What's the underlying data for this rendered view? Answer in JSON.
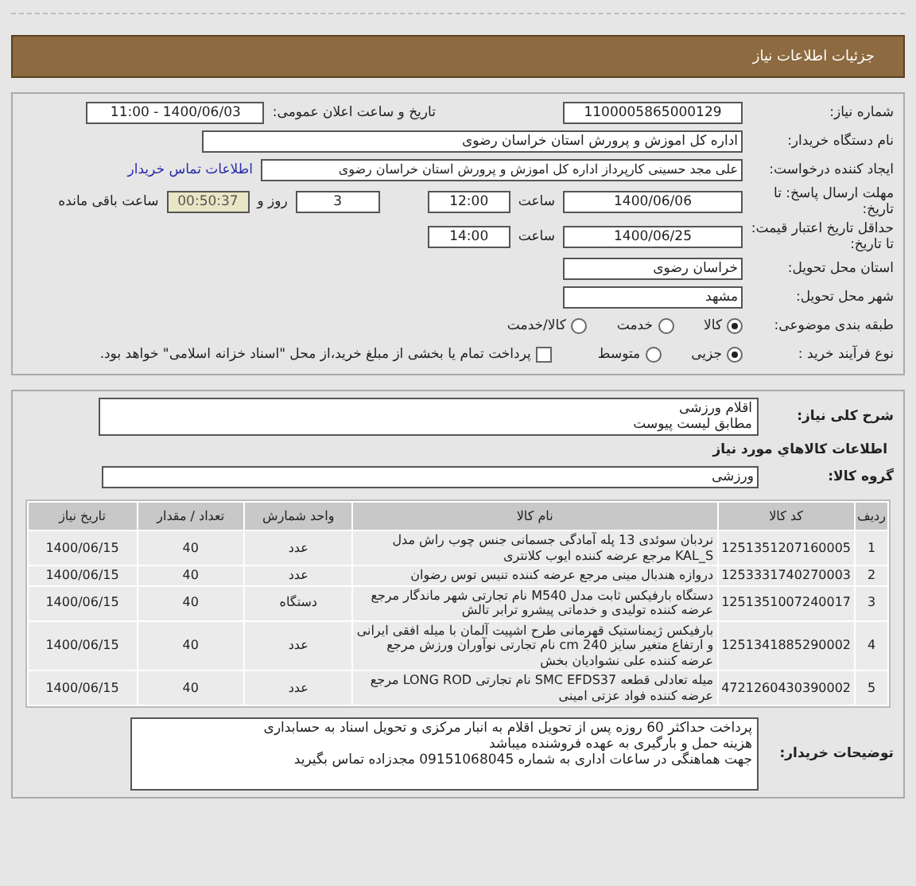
{
  "header": {
    "title": "جزئیات اطلاعات نیاز"
  },
  "need_number": {
    "label": "شماره نیاز:",
    "value": "1100005865000129"
  },
  "announce": {
    "label": "تاریخ و ساعت اعلان عمومی:",
    "value": "1400/06/03 - 11:00"
  },
  "buyer": {
    "label": "نام دستگاه خریدار:",
    "value": "اداره کل اموزش و پرورش استان خراسان رضوی"
  },
  "requester": {
    "label": "ایجاد کننده درخواست:",
    "value": "علی مجد حسینی کارپرداز اداره کل اموزش و پرورش استان خراسان رضوی",
    "link": "اطلاعات تماس خریدار"
  },
  "deadline": {
    "label": "مهلت ارسال پاسخ: تا تاریخ:",
    "date": "1400/06/06",
    "time_label": "ساعت",
    "time": "12:00",
    "days": "3",
    "days_label": "روز و",
    "remaining": "00:50:37",
    "remaining_label": "ساعت باقی مانده"
  },
  "validity": {
    "label": "حداقل تاریخ اعتبار قیمت: تا تاریخ:",
    "date": "1400/06/25",
    "time_label": "ساعت",
    "time": "14:00"
  },
  "province": {
    "label": "استان محل تحویل:",
    "value": "خراسان رضوی"
  },
  "city": {
    "label": "شهر محل تحویل:",
    "value": "مشهد"
  },
  "category": {
    "label": "طبقه بندی موضوعی:",
    "options": [
      {
        "label": "کالا",
        "selected": true
      },
      {
        "label": "خدمت",
        "selected": false
      },
      {
        "label": "کالا/خدمت",
        "selected": false
      }
    ]
  },
  "purchase_type": {
    "label": "نوع فرآیند خرید :",
    "options": [
      {
        "label": "جزیی",
        "selected": true
      },
      {
        "label": "متوسط",
        "selected": false
      }
    ],
    "payment": {
      "label": "پرداخت تمام یا بخشی از مبلغ خرید،از محل \"اسناد خزانه اسلامی\" خواهد بود.",
      "checked": false
    }
  },
  "description": {
    "label": "شرح کلی نیاز:",
    "lines": [
      "اقلام ورزشی",
      "مطابق لیست پیوست"
    ]
  },
  "goods_title": "اطلاعات کالاهاي مورد نیاز",
  "group": {
    "label": "گروه کالا:",
    "value": "ورزشی"
  },
  "table": {
    "columns": [
      "ردیف",
      "کد کالا",
      "نام کالا",
      "واحد شمارش",
      "تعداد / مقدار",
      "تاریخ نیاز"
    ],
    "rows": [
      [
        "1",
        "1251351207160005",
        "نردبان سوئدی 13 پله آمادگی جسمانی جنس چوب راش مدل KAL_S مرجع عرضه کننده ایوب کلانتری",
        "عدد",
        "40",
        "1400/06/15"
      ],
      [
        "2",
        "1253331740270003",
        "دروازه هندبال مینی مرجع عرضه کننده تنیس توس رضوان",
        "عدد",
        "40",
        "1400/06/15"
      ],
      [
        "3",
        "1251351007240017",
        "دستگاه بارفیکس ثابت مدل M540 نام تجارتی شهر ماندگار مرجع عرضه کننده تولیدی و خدماتی پیشرو ترابر تالش",
        "دستگاه",
        "40",
        "1400/06/15"
      ],
      [
        "4",
        "1251341885290002",
        "بارفیکس ژیمناستیک قهرمانی طرح اشپیت آلمان با میله افقی ایرانی و ارتفاع متغیر سایز 240 cm نام تجارتی نوآوران ورزش مرجع عرضه کننده علی نشوادیان بخش",
        "عدد",
        "40",
        "1400/06/15"
      ],
      [
        "5",
        "4721260430390002",
        "میله تعادلی قطعه SMC EFDS37 نام تجارتی LONG ROD مرجع عرضه کننده فواد عزتی امینی",
        "عدد",
        "40",
        "1400/06/15"
      ]
    ]
  },
  "notes": {
    "label": "توضیحات خریدار:",
    "lines": [
      "پرداخت حداکثر 60 روزه پس از تحویل اقلام به انبار مرکزی و تحویل اسناد به حسابداری",
      "هزینه حمل و بارگیری به عهده فروشنده میباشد",
      "جهت هماهنگی در ساعات اداری به شماره 09151068045 مجدزاده تماس بگیرید"
    ]
  }
}
